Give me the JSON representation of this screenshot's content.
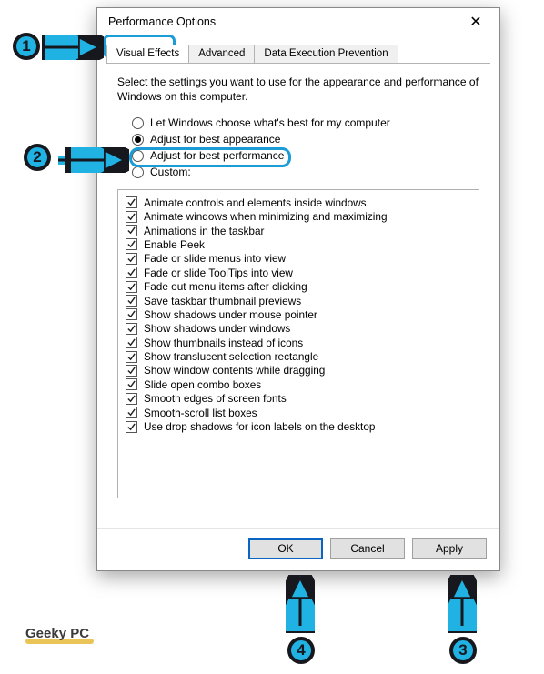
{
  "dialog": {
    "title": "Performance Options",
    "tabs": [
      {
        "label": "Visual Effects",
        "active": true
      },
      {
        "label": "Advanced",
        "active": false
      },
      {
        "label": "Data Execution Prevention",
        "active": false
      }
    ],
    "description": "Select the settings you want to use for the appearance and performance of Windows on this computer.",
    "radios": [
      {
        "label": "Let Windows choose what's best for my computer",
        "checked": false
      },
      {
        "label": "Adjust for best appearance",
        "checked": true
      },
      {
        "label": "Adjust for best performance",
        "checked": false
      },
      {
        "label": "Custom:",
        "checked": false
      }
    ],
    "checks": [
      "Animate controls and elements inside windows",
      "Animate windows when minimizing and maximizing",
      "Animations in the taskbar",
      "Enable Peek",
      "Fade or slide menus into view",
      "Fade or slide ToolTips into view",
      "Fade out menu items after clicking",
      "Save taskbar thumbnail previews",
      "Show shadows under mouse pointer",
      "Show shadows under windows",
      "Show thumbnails instead of icons",
      "Show translucent selection rectangle",
      "Show window contents while dragging",
      "Slide open combo boxes",
      "Smooth edges of screen fonts",
      "Smooth-scroll list boxes",
      "Use drop shadows for icon labels on the desktop"
    ],
    "buttons": {
      "ok": "OK",
      "cancel": "Cancel",
      "apply": "Apply"
    }
  },
  "annotations": {
    "callouts": [
      "1",
      "2",
      "3",
      "4"
    ],
    "watermark": "Geeky PC"
  }
}
